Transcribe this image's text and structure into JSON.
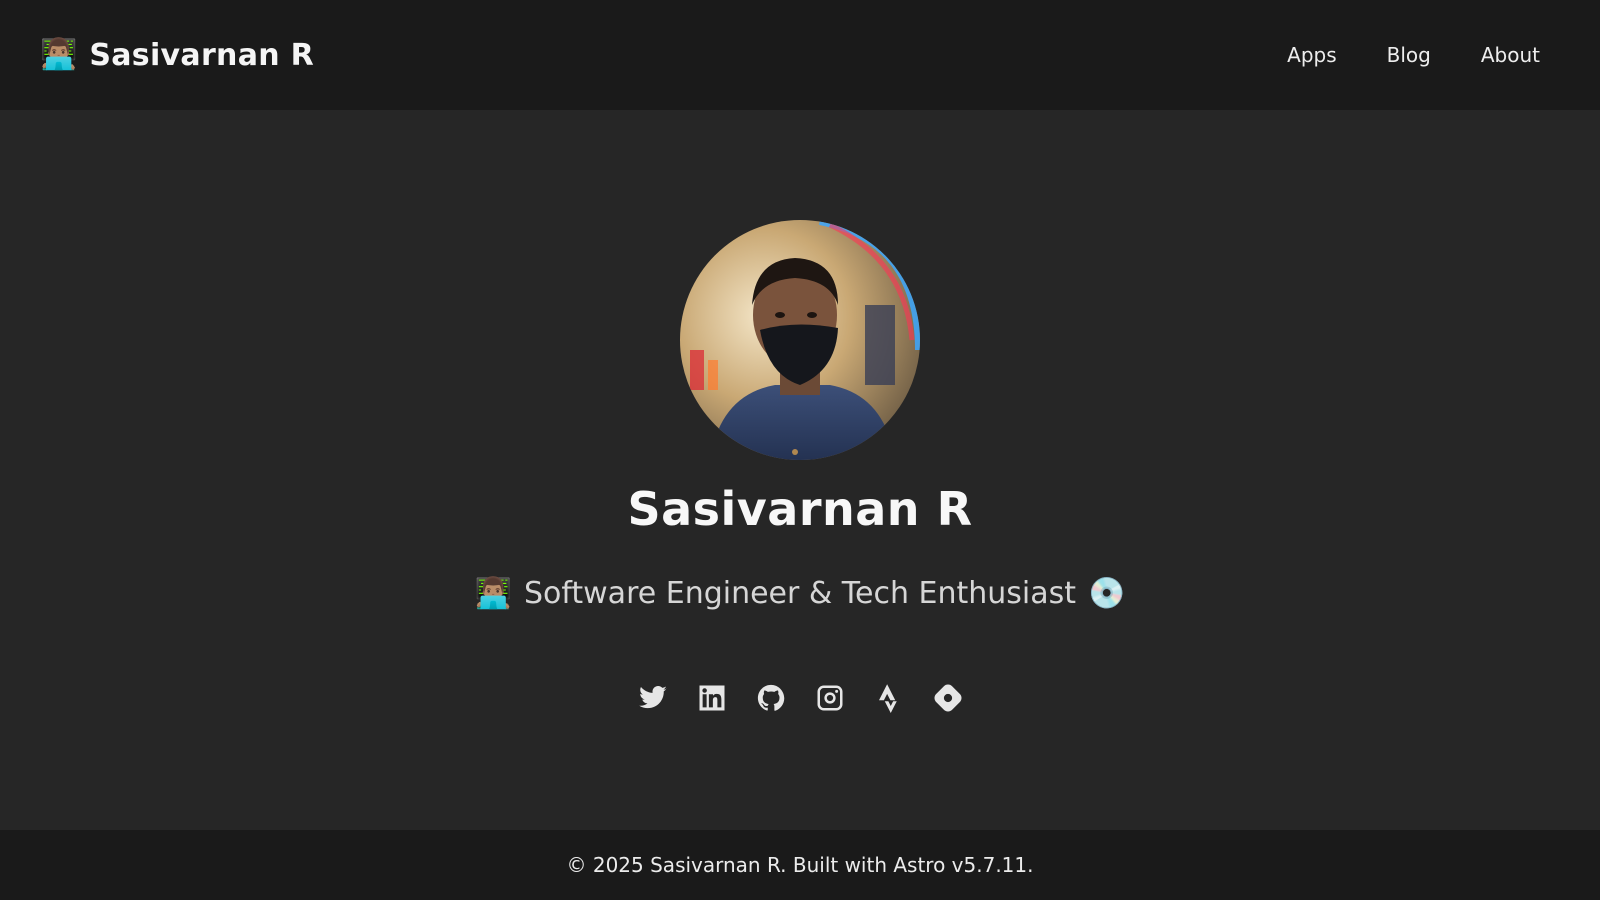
{
  "header": {
    "brand_emoji": "👨🏽‍💻",
    "brand_name": "Sasivarnan R",
    "nav": [
      {
        "label": "Apps"
      },
      {
        "label": "Blog"
      },
      {
        "label": "About"
      }
    ]
  },
  "hero": {
    "avatar_icon": "profile-photo",
    "name": "Sasivarnan R",
    "tagline_emoji_left": "👨🏽‍💻",
    "tagline_text": "Software Engineer & Tech Enthusiast",
    "tagline_emoji_right": "💿"
  },
  "socials": [
    {
      "icon": "twitter-icon"
    },
    {
      "icon": "linkedin-icon"
    },
    {
      "icon": "github-icon"
    },
    {
      "icon": "instagram-icon"
    },
    {
      "icon": "strava-icon"
    },
    {
      "icon": "hashnode-icon"
    }
  ],
  "footer": {
    "text": "© 2025 Sasivarnan R. Built with Astro v5.7.11."
  },
  "colors": {
    "page_bg": "#262626",
    "bar_bg": "#1a1a1a",
    "text": "#f2f2f2"
  }
}
